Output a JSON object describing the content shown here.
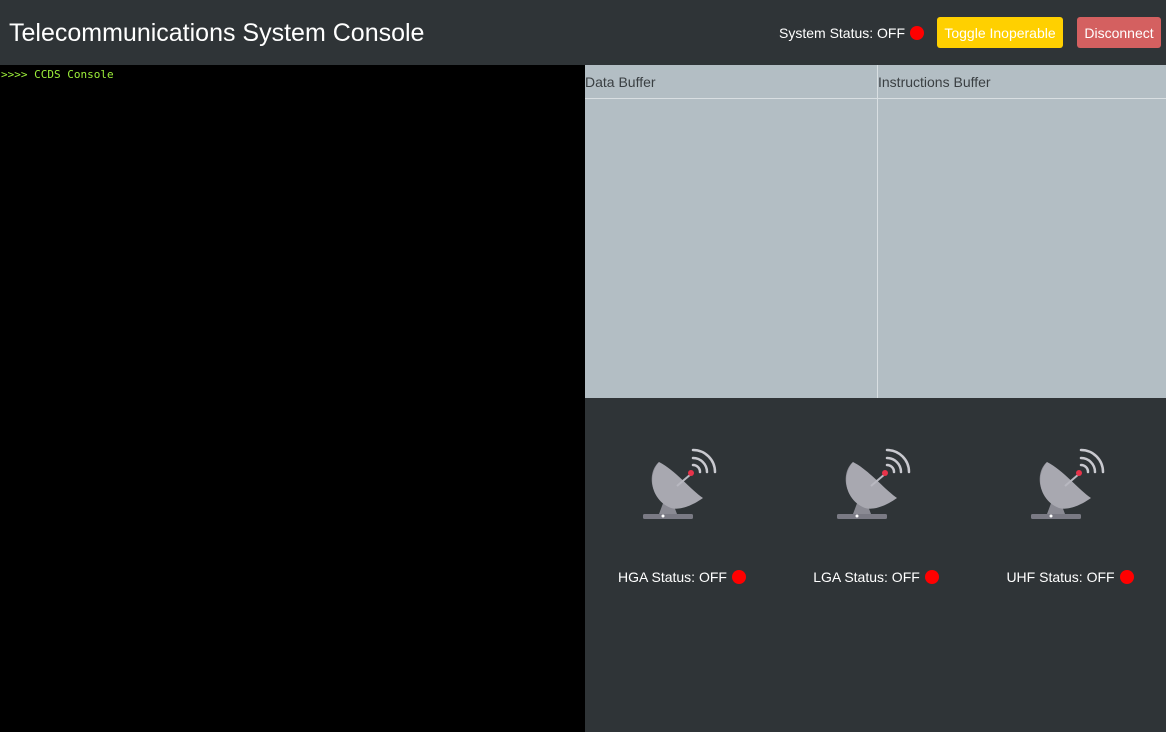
{
  "header": {
    "title": "Telecommunications System Console",
    "system_status": "System Status: OFF",
    "toggle_label": "Toggle Inoperable",
    "disconnect_label": "Disconnect"
  },
  "console": {
    "prompt": ">>>> CCDS Console"
  },
  "buffers": {
    "data_label": "Data Buffer",
    "instructions_label": "Instructions Buffer"
  },
  "antennas": [
    {
      "icon": "satellite-dish-icon",
      "status": "HGA Status: OFF"
    },
    {
      "icon": "satellite-dish-icon",
      "status": "LGA Status: OFF"
    },
    {
      "icon": "satellite-dish-icon",
      "status": "UHF Status: OFF"
    }
  ],
  "colors": {
    "status_off": "#ff0000",
    "toggle_button": "#ffd000",
    "disconnect_button": "#d46060",
    "console_text": "#9df03a"
  }
}
